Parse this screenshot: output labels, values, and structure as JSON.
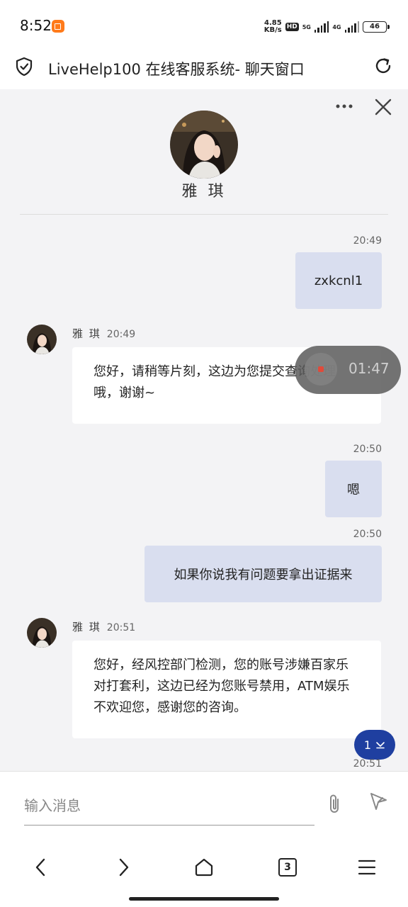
{
  "status_bar": {
    "time": "8:52",
    "speed_value": "4.85",
    "speed_unit": "KB/s",
    "hd_badge": "HD",
    "network": "5G",
    "network2": "4G",
    "battery": "46"
  },
  "browser": {
    "page_title": "LiveHelp100 在线客服系统- 聊天窗口"
  },
  "chat": {
    "agent_name": "雅 琪",
    "messages": [
      {
        "direction": "out",
        "time": "20:49",
        "text": "zxkcnl1"
      },
      {
        "direction": "in",
        "sender": "雅 琪",
        "time": "20:49",
        "text": "您好，请稍等片刻，这边为您提交查询处理哦，谢谢~"
      },
      {
        "direction": "out",
        "time": "20:50",
        "text": "嗯"
      },
      {
        "direction": "out",
        "time": "20:50",
        "text": "如果你说我有问题要拿出证据来"
      },
      {
        "direction": "in",
        "sender": "雅 琪",
        "time": "20:51",
        "text": "您好，经风控部门检测，您的账号涉嫌百家乐对打套利，这边已经为您账号禁用，ATM娱乐不欢迎您，感谢您的咨询。"
      },
      {
        "direction": "out",
        "time": "20:51",
        "text": ""
      }
    ],
    "recording_timer": "01:47",
    "unread_count": "1"
  },
  "input": {
    "placeholder": "输入消息"
  },
  "nav": {
    "tab_count": "3"
  },
  "icons": [
    "shield-icon",
    "reload-icon",
    "more-icon",
    "close-icon",
    "attach-icon",
    "send-icon",
    "back-icon",
    "forward-icon",
    "home-icon",
    "tabs-icon",
    "menu-icon"
  ],
  "colors": {
    "outgoing_bubble": "#d9deef",
    "incoming_bubble": "#ffffff",
    "chat_background": "#f3f3f5",
    "unread_pill": "#1f3fa0"
  }
}
